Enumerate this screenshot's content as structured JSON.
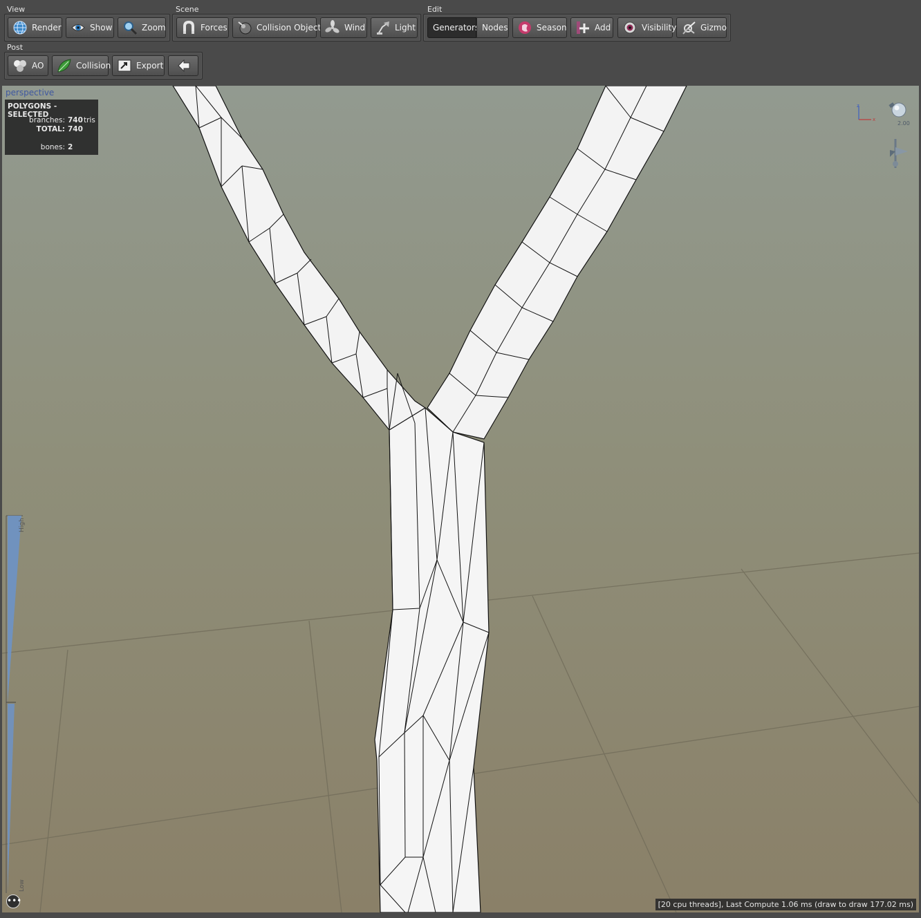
{
  "toolbar": {
    "view": {
      "title": "View",
      "buttons": [
        {
          "label": "Render",
          "icon": "globe-icon"
        },
        {
          "label": "Show",
          "icon": "eye-icon"
        },
        {
          "label": "Zoom",
          "icon": "magnifier-icon"
        }
      ]
    },
    "scene": {
      "title": "Scene",
      "buttons": [
        {
          "label": "Forces",
          "icon": "magnet-icon"
        },
        {
          "label": "Collision Objects",
          "icon": "sphere-icon"
        },
        {
          "label": "Wind",
          "icon": "fan-icon"
        },
        {
          "label": "Light",
          "icon": "lamp-icon"
        }
      ]
    },
    "edit": {
      "title": "Edit",
      "segment": [
        {
          "label": "Generators",
          "active": true
        },
        {
          "label": "Nodes",
          "active": false
        }
      ],
      "buttons": [
        {
          "label": "Season",
          "icon": "season-icon"
        },
        {
          "label": "Add",
          "icon": "add-icon"
        },
        {
          "label": "Visibility",
          "icon": "visibility-icon"
        },
        {
          "label": "Gizmo",
          "icon": "gizmo-icon"
        }
      ]
    },
    "post": {
      "title": "Post",
      "buttons": [
        {
          "label": "AO",
          "icon": "ao-icon"
        },
        {
          "label": "Collision",
          "icon": "leaf-icon"
        },
        {
          "label": "Export",
          "icon": "export-icon"
        },
        {
          "label": "",
          "icon": "back-arrow-icon"
        }
      ]
    }
  },
  "viewport": {
    "camera_label": "perspective",
    "stats": {
      "title": "POLYGONS - SELECTED",
      "branches_label": "branches:",
      "branches_value": "740",
      "branches_unit": "tris",
      "total_label": "TOTAL:",
      "total_value": "740",
      "bones_label": "bones:",
      "bones_value": "2"
    },
    "light_value": "2.00",
    "scale_high": "High",
    "scale_low": "Low",
    "status": "[20 cpu threads], Last Compute 1.06 ms (draw to draw 177.02 ms)",
    "more_button": "•••",
    "colors": {
      "mesh": "#f2f2f2",
      "wire": "#111111",
      "stats_bg": "#282828",
      "camera_label": "#3f58a0"
    }
  }
}
